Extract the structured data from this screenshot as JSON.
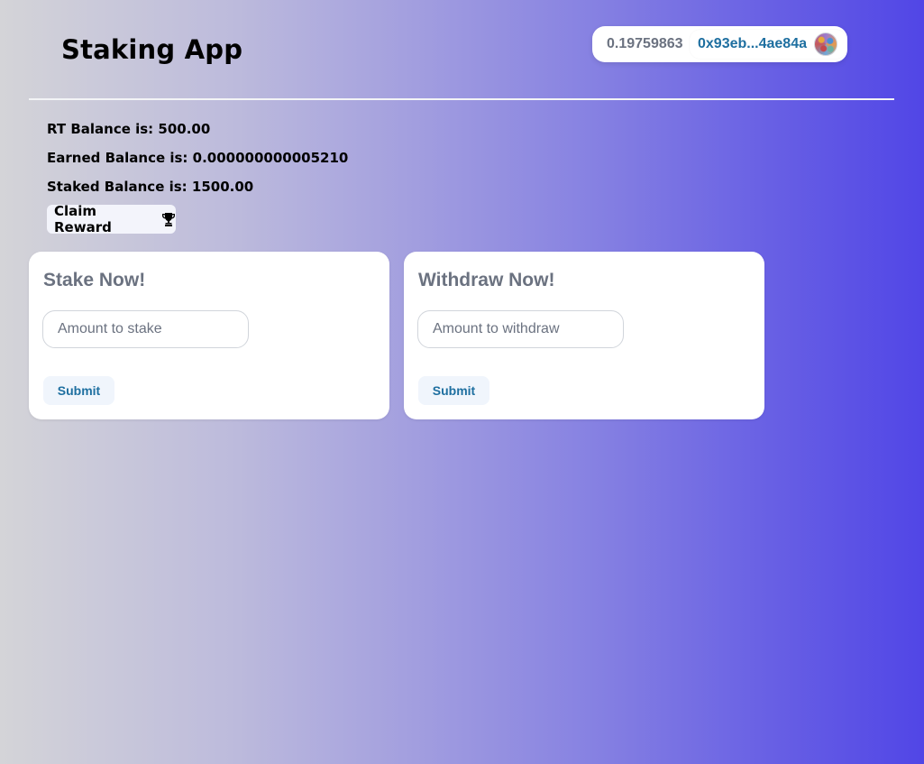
{
  "header": {
    "title": "Staking App",
    "wallet": {
      "balance": "0.19759863",
      "address": "0x93eb...4ae84a",
      "avatar_icon": "account-avatar"
    }
  },
  "balances": {
    "rt": "RT Balance is: 500.00",
    "earned": "Earned Balance is: 0.000000000005210",
    "staked": "Staked Balance is: 1500.00"
  },
  "claim": {
    "label": "Claim Reward",
    "icon": "trophy-icon"
  },
  "stake_card": {
    "title": "Stake Now!",
    "placeholder": "Amount to stake",
    "submit_label": "Submit"
  },
  "withdraw_card": {
    "title": "Withdraw Now!",
    "placeholder": "Amount to withdraw",
    "submit_label": "Submit"
  },
  "colors": {
    "gradient_start": "#d4d4d8",
    "gradient_end": "#5146e6",
    "accent": "#1e6fa0",
    "muted_text": "#6b7280"
  }
}
